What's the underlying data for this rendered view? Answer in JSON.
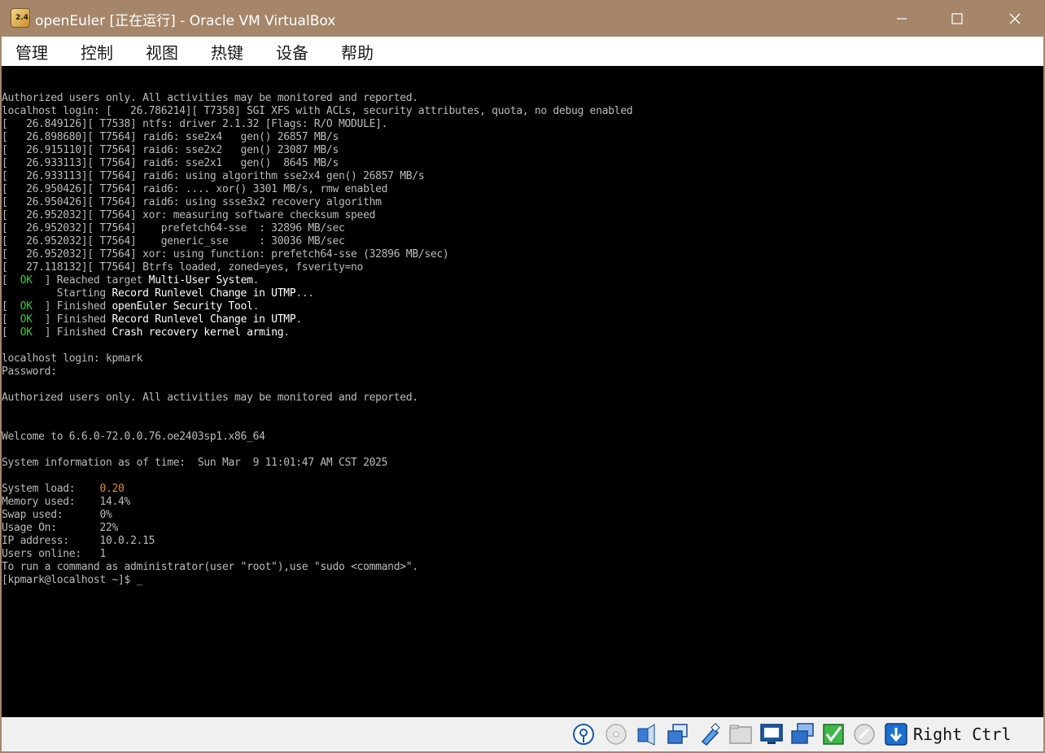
{
  "window": {
    "app_icon_text": "2.4",
    "title": "openEuler [正在运行] - Oracle VM VirtualBox",
    "minimize_glyph": "—",
    "maximize_glyph": "☐",
    "close_glyph": "✕"
  },
  "menu": [
    "管理",
    "控制",
    "视图",
    "热键",
    "设备",
    "帮助"
  ],
  "console": {
    "lines": [
      "Authorized users only. All activities may be monitored and reported.",
      "localhost login: [   26.786214][ T7358] SGI XFS with ACLs, security attributes, quota, no debug enabled",
      "[   26.849126][ T7538] ntfs: driver 2.1.32 [Flags: R/O MODULE].",
      "[   26.898680][ T7564] raid6: sse2x4   gen() 26857 MB/s",
      "[   26.915110][ T7564] raid6: sse2x2   gen() 23087 MB/s",
      "[   26.933113][ T7564] raid6: sse2x1   gen()  8645 MB/s",
      "[   26.933113][ T7564] raid6: using algorithm sse2x4 gen() 26857 MB/s",
      "[   26.950426][ T7564] raid6: .... xor() 3301 MB/s, rmw enabled",
      "[   26.950426][ T7564] raid6: using ssse3x2 recovery algorithm",
      "[   26.952032][ T7564] xor: measuring software checksum speed",
      "[   26.952032][ T7564]    prefetch64-sse  : 32896 MB/sec",
      "[   26.952032][ T7564]    generic_sse     : 30036 MB/sec",
      "[   26.952032][ T7564] xor: using function: prefetch64-sse (32896 MB/sec)",
      "[   27.118132][ T7564] Btrfs loaded, zoned=yes, fsverity=no"
    ],
    "status_lines": [
      {
        "ok": "OK",
        "verb": "Reached target",
        "target": "Multi-User System",
        "tail": "."
      },
      {
        "ok": "",
        "verb": "Starting",
        "target": "Record Runlevel Change in UTMP",
        "tail": "..."
      },
      {
        "ok": "OK",
        "verb": "Finished",
        "target": "openEuler Security Tool",
        "tail": "."
      },
      {
        "ok": "OK",
        "verb": "Finished",
        "target": "Record Runlevel Change in UTMP",
        "tail": "."
      },
      {
        "ok": "OK",
        "verb": "Finished",
        "target": "Crash recovery kernel arming",
        "tail": "."
      }
    ],
    "login_prompt": "localhost login: kpmark",
    "password_prompt": "Password:",
    "authorized_notice": "Authorized users only. All activities may be monitored and reported.",
    "welcome": "Welcome to 6.6.0-72.0.0.76.oe2403sp1.x86_64",
    "sysinfo_time": "System information as of time:  Sun Mar  9 11:01:47 AM CST 2025",
    "stats": [
      {
        "label": "System load:",
        "value": "0.20",
        "warn": true
      },
      {
        "label": "Memory used:",
        "value": "14.4%",
        "warn": false
      },
      {
        "label": "Swap used:",
        "value": "0%",
        "warn": false
      },
      {
        "label": "Usage On:",
        "value": "22%",
        "warn": false
      },
      {
        "label": "IP address:",
        "value": "10.0.2.15",
        "warn": false
      },
      {
        "label": "Users online:",
        "value": "1",
        "warn": false
      }
    ],
    "sudo_hint": "To run a command as administrator(user \"root\"),use \"sudo <command>\".",
    "prompt": "[kpmark@localhost ~]$ ",
    "cursor": "_"
  },
  "statusbar": {
    "icons": [
      "hard-disk-icon",
      "optical-drive-icon",
      "audio-icon",
      "network-icon",
      "usb-icon",
      "shared-folders-icon",
      "display-icon",
      "recording-icon",
      "cpu-icon",
      "mouse-integration-icon",
      "keyboard-host-icon"
    ],
    "host_key": "Right Ctrl"
  }
}
